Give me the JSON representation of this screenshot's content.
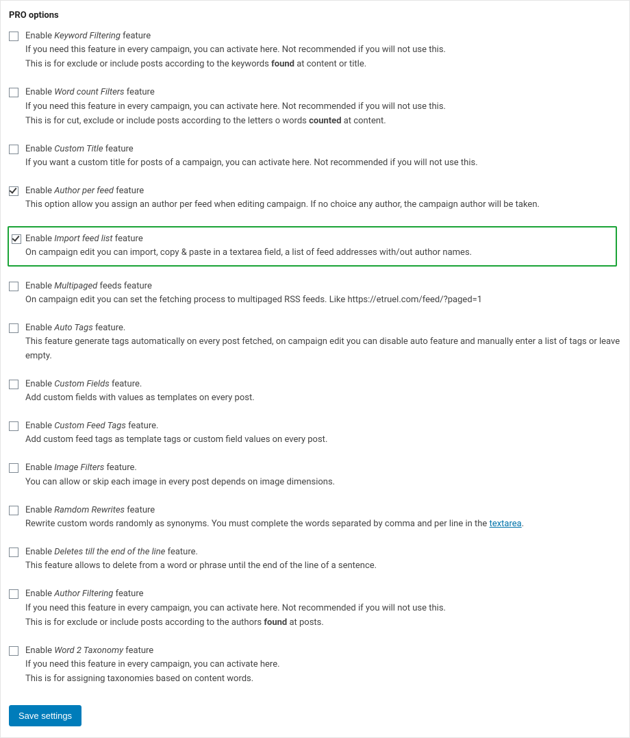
{
  "panel_title": "PRO options",
  "options": {
    "keyword_filtering": {
      "label_pre": "Enable ",
      "label_em": "Keyword Filtering",
      "label_post": " feature",
      "desc_line1": "If you need this feature in every campaign, you can activate here. Not recommended if you will not use this.",
      "desc_line2_pre": "This is for exclude or include posts according to the keywords ",
      "desc_line2_bold": "found",
      "desc_line2_post": " at content or title."
    },
    "word_count": {
      "label_pre": "Enable ",
      "label_em": "Word count Filters",
      "label_post": " feature",
      "desc_line1": "If you need this feature in every campaign, you can activate here. Not recommended if you will not use this.",
      "desc_line2_pre": "This is for cut, exclude or include posts according to the letters o words ",
      "desc_line2_bold": "counted",
      "desc_line2_post": " at content."
    },
    "custom_title": {
      "label_pre": "Enable ",
      "label_em": "Custom Title",
      "label_post": " feature",
      "desc": "If you want a custom title for posts of a campaign, you can activate here. Not recommended if you will not use this."
    },
    "author_per_feed": {
      "label_pre": "Enable ",
      "label_em": "Author per feed",
      "label_post": " feature",
      "desc": "This option allow you assign an author per feed when editing campaign. If no choice any author, the campaign author will be taken."
    },
    "import_feed_list": {
      "label_pre": "Enable ",
      "label_em": "Import feed list",
      "label_post": " feature",
      "desc": "On campaign edit you can import, copy & paste in a textarea field, a list of feed addresses with/out author names."
    },
    "multipaged": {
      "label_pre": "Enable ",
      "label_em": "Multipaged",
      "label_post": " feeds feature",
      "desc": "On campaign edit you can set the fetching process to multipaged RSS feeds. Like https://etruel.com/feed/?paged=1"
    },
    "auto_tags": {
      "label_pre": "Enable ",
      "label_em": "Auto Tags",
      "label_post": " feature.",
      "desc": "This feature generate tags automatically on every post fetched, on campaign edit you can disable auto feature and manually enter a list of tags or leave empty."
    },
    "custom_fields": {
      "label_pre": "Enable ",
      "label_em": "Custom Fields",
      "label_post": " feature.",
      "desc": "Add custom fields with values as templates on every post."
    },
    "custom_feed_tags": {
      "label_pre": "Enable ",
      "label_em": "Custom Feed Tags",
      "label_post": " feature.",
      "desc": "Add custom feed tags as template tags or custom field values on every post."
    },
    "image_filters": {
      "label_pre": "Enable ",
      "label_em": "Image Filters",
      "label_post": " feature.",
      "desc": "You can allow or skip each image in every post depends on image dimensions."
    },
    "random_rewrites": {
      "label_pre": "Enable ",
      "label_em": "Ramdom Rewrites",
      "label_post": " feature",
      "desc_pre": "Rewrite custom words randomly as synonyms. You must complete the words separated by comma and per line in the ",
      "desc_link": "textarea",
      "desc_post": "."
    },
    "deletes_eol": {
      "label_pre": "Enable ",
      "label_em": "Deletes till the end of the line",
      "label_post": " feature.",
      "desc": "This feature allows to delete from a word or phrase until the end of the line of a sentence."
    },
    "author_filtering": {
      "label_pre": "Enable ",
      "label_em": "Author Filtering",
      "label_post": " feature",
      "desc_line1": "If you need this feature in every campaign, you can activate here. Not recommended if you will not use this.",
      "desc_line2_pre": "This is for exclude or include posts according to the authors ",
      "desc_line2_bold": "found",
      "desc_line2_post": " at posts."
    },
    "word2taxonomy": {
      "label_pre": "Enable ",
      "label_em": "Word 2 Taxonomy",
      "label_post": " feature",
      "desc_line1": "If you need this feature in every campaign, you can activate here.",
      "desc_line2": "This is for assigning taxonomies based on content words."
    }
  },
  "save_button": "Save settings"
}
